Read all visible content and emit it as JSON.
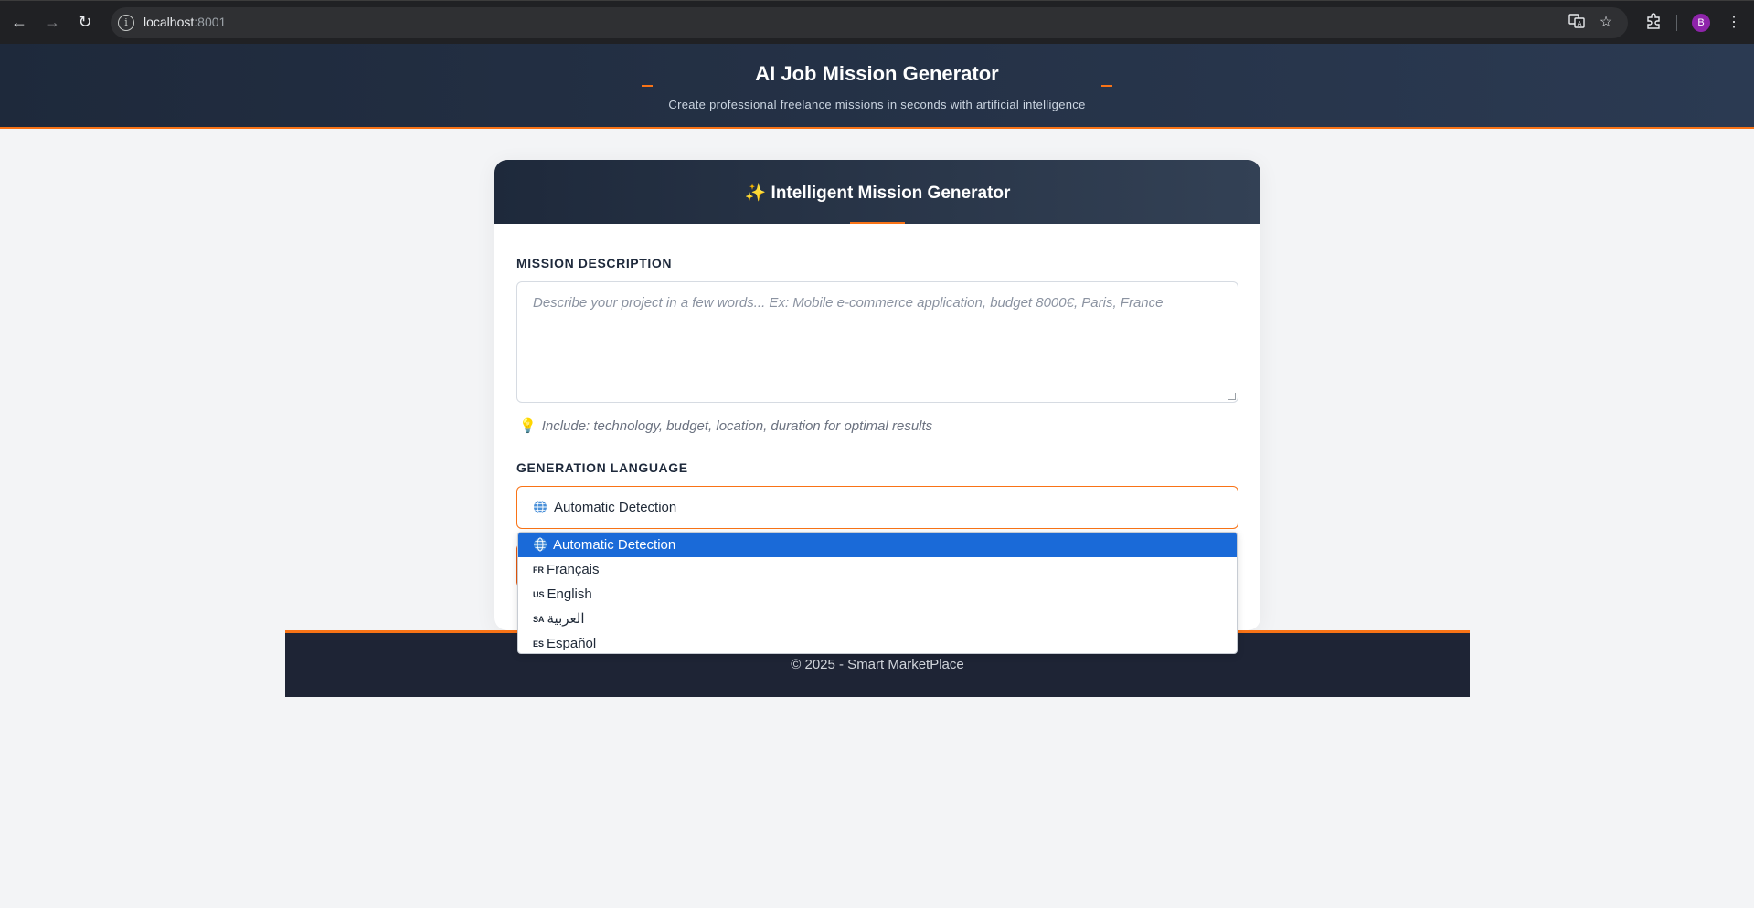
{
  "browser": {
    "url_host": "localhost",
    "url_port": ":8001",
    "profile_initial": "B"
  },
  "header": {
    "title": "AI Job Mission Generator",
    "subtitle": "Create professional freelance missions in seconds with artificial intelligence"
  },
  "card": {
    "title": "✨ Intelligent Mission Generator",
    "description_label": "MISSION DESCRIPTION",
    "description_placeholder": "Describe your project in a few words... Ex: Mobile e-commerce application, budget 8000€, Paris, France",
    "description_value": "",
    "hint_icon": "💡",
    "hint": "Include: technology, budget, location, duration for optimal results",
    "language_label": "GENERATION LANGUAGE",
    "language_value": "Automatic Detection"
  },
  "dropdown": {
    "options": [
      {
        "flag": "",
        "label": "Automatic Detection",
        "selected": true
      },
      {
        "flag": "FR",
        "label": "Français",
        "selected": false
      },
      {
        "flag": "US",
        "label": "English",
        "selected": false
      },
      {
        "flag": "SA",
        "label": "العربية",
        "selected": false
      },
      {
        "flag": "ES",
        "label": "Español",
        "selected": false
      }
    ]
  },
  "footer": {
    "text": "© 2025 - Smart MarketPlace"
  },
  "colors": {
    "accent": "#f97316",
    "header_bg": "#1e293b",
    "selected_option": "#1a6ad8"
  }
}
